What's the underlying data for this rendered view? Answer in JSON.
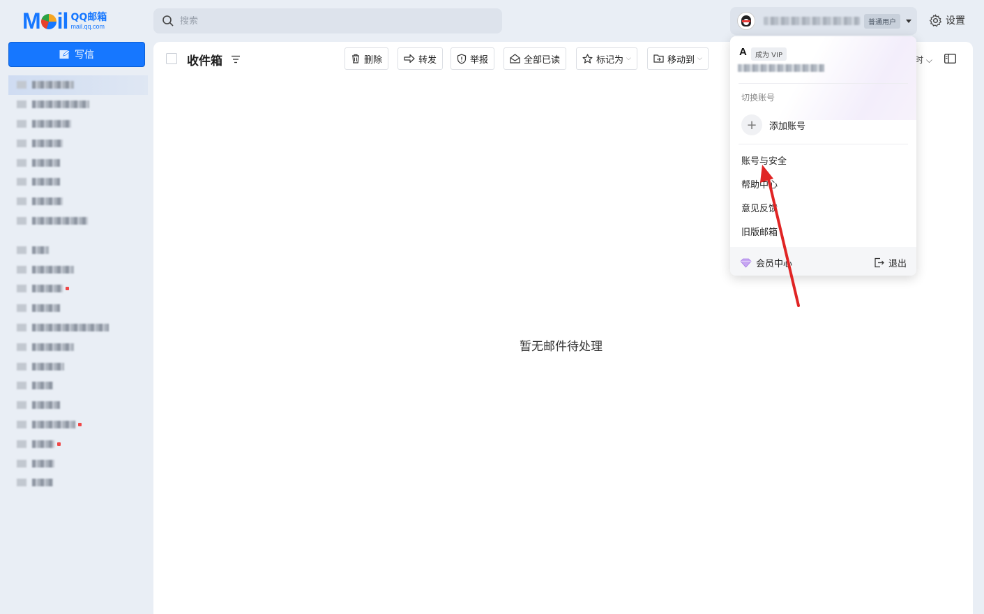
{
  "logo": {
    "main": "Mail",
    "cn": "QQ邮箱",
    "domain": "mail.qq.com"
  },
  "search": {
    "placeholder": "搜索"
  },
  "user": {
    "tag": "普通用户"
  },
  "settings": {
    "label": "设置"
  },
  "compose": {
    "label": "写信"
  },
  "sidebar": {
    "items": [
      {
        "active": true,
        "w": 60
      },
      {
        "w": 82
      },
      {
        "w": 56
      },
      {
        "w": 44
      },
      {
        "w": 40
      },
      {
        "w": 40
      },
      {
        "w": 44
      },
      {
        "w": 80
      },
      {
        "gap": true
      },
      {
        "w": 24
      },
      {
        "w": 60
      },
      {
        "w": 44,
        "dot": true
      },
      {
        "w": 40
      },
      {
        "w": 110
      },
      {
        "w": 60
      },
      {
        "w": 46
      },
      {
        "w": 30
      },
      {
        "w": 40
      },
      {
        "w": 62,
        "dot": true
      },
      {
        "w": 32,
        "dot": true
      },
      {
        "w": 32
      },
      {
        "w": 30
      }
    ]
  },
  "main": {
    "title": "收件箱",
    "toolbar": {
      "delete": "删除",
      "forward": "转发",
      "report": "举报",
      "mark_all_read": "全部已读",
      "mark_as": "标记为",
      "move_to": "移动到",
      "partial": "时"
    },
    "empty_text": "暂无邮件待处理"
  },
  "dropdown": {
    "initial": "A",
    "vip_badge": "成为 VIP",
    "switch_label": "切换账号",
    "add_account": "添加账号",
    "menu": [
      "账号与安全",
      "帮助中心",
      "意见反馈",
      "旧版邮箱"
    ],
    "vip_center": "会员中心",
    "logout": "退出"
  },
  "colors": {
    "brand": "#1677ff",
    "annotation": "#e02424"
  }
}
